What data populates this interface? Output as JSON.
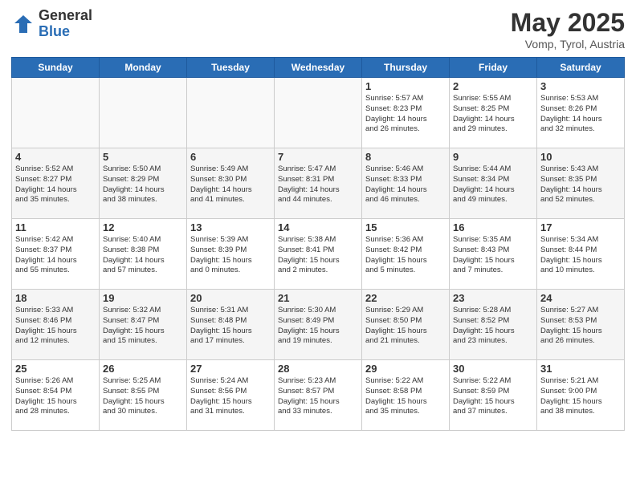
{
  "header": {
    "logo_general": "General",
    "logo_blue": "Blue",
    "month_title": "May 2025",
    "location": "Vomp, Tyrol, Austria"
  },
  "days_of_week": [
    "Sunday",
    "Monday",
    "Tuesday",
    "Wednesday",
    "Thursday",
    "Friday",
    "Saturday"
  ],
  "weeks": [
    [
      {
        "day": "",
        "info": ""
      },
      {
        "day": "",
        "info": ""
      },
      {
        "day": "",
        "info": ""
      },
      {
        "day": "",
        "info": ""
      },
      {
        "day": "1",
        "info": "Sunrise: 5:57 AM\nSunset: 8:23 PM\nDaylight: 14 hours\nand 26 minutes."
      },
      {
        "day": "2",
        "info": "Sunrise: 5:55 AM\nSunset: 8:25 PM\nDaylight: 14 hours\nand 29 minutes."
      },
      {
        "day": "3",
        "info": "Sunrise: 5:53 AM\nSunset: 8:26 PM\nDaylight: 14 hours\nand 32 minutes."
      }
    ],
    [
      {
        "day": "4",
        "info": "Sunrise: 5:52 AM\nSunset: 8:27 PM\nDaylight: 14 hours\nand 35 minutes."
      },
      {
        "day": "5",
        "info": "Sunrise: 5:50 AM\nSunset: 8:29 PM\nDaylight: 14 hours\nand 38 minutes."
      },
      {
        "day": "6",
        "info": "Sunrise: 5:49 AM\nSunset: 8:30 PM\nDaylight: 14 hours\nand 41 minutes."
      },
      {
        "day": "7",
        "info": "Sunrise: 5:47 AM\nSunset: 8:31 PM\nDaylight: 14 hours\nand 44 minutes."
      },
      {
        "day": "8",
        "info": "Sunrise: 5:46 AM\nSunset: 8:33 PM\nDaylight: 14 hours\nand 46 minutes."
      },
      {
        "day": "9",
        "info": "Sunrise: 5:44 AM\nSunset: 8:34 PM\nDaylight: 14 hours\nand 49 minutes."
      },
      {
        "day": "10",
        "info": "Sunrise: 5:43 AM\nSunset: 8:35 PM\nDaylight: 14 hours\nand 52 minutes."
      }
    ],
    [
      {
        "day": "11",
        "info": "Sunrise: 5:42 AM\nSunset: 8:37 PM\nDaylight: 14 hours\nand 55 minutes."
      },
      {
        "day": "12",
        "info": "Sunrise: 5:40 AM\nSunset: 8:38 PM\nDaylight: 14 hours\nand 57 minutes."
      },
      {
        "day": "13",
        "info": "Sunrise: 5:39 AM\nSunset: 8:39 PM\nDaylight: 15 hours\nand 0 minutes."
      },
      {
        "day": "14",
        "info": "Sunrise: 5:38 AM\nSunset: 8:41 PM\nDaylight: 15 hours\nand 2 minutes."
      },
      {
        "day": "15",
        "info": "Sunrise: 5:36 AM\nSunset: 8:42 PM\nDaylight: 15 hours\nand 5 minutes."
      },
      {
        "day": "16",
        "info": "Sunrise: 5:35 AM\nSunset: 8:43 PM\nDaylight: 15 hours\nand 7 minutes."
      },
      {
        "day": "17",
        "info": "Sunrise: 5:34 AM\nSunset: 8:44 PM\nDaylight: 15 hours\nand 10 minutes."
      }
    ],
    [
      {
        "day": "18",
        "info": "Sunrise: 5:33 AM\nSunset: 8:46 PM\nDaylight: 15 hours\nand 12 minutes."
      },
      {
        "day": "19",
        "info": "Sunrise: 5:32 AM\nSunset: 8:47 PM\nDaylight: 15 hours\nand 15 minutes."
      },
      {
        "day": "20",
        "info": "Sunrise: 5:31 AM\nSunset: 8:48 PM\nDaylight: 15 hours\nand 17 minutes."
      },
      {
        "day": "21",
        "info": "Sunrise: 5:30 AM\nSunset: 8:49 PM\nDaylight: 15 hours\nand 19 minutes."
      },
      {
        "day": "22",
        "info": "Sunrise: 5:29 AM\nSunset: 8:50 PM\nDaylight: 15 hours\nand 21 minutes."
      },
      {
        "day": "23",
        "info": "Sunrise: 5:28 AM\nSunset: 8:52 PM\nDaylight: 15 hours\nand 23 minutes."
      },
      {
        "day": "24",
        "info": "Sunrise: 5:27 AM\nSunset: 8:53 PM\nDaylight: 15 hours\nand 26 minutes."
      }
    ],
    [
      {
        "day": "25",
        "info": "Sunrise: 5:26 AM\nSunset: 8:54 PM\nDaylight: 15 hours\nand 28 minutes."
      },
      {
        "day": "26",
        "info": "Sunrise: 5:25 AM\nSunset: 8:55 PM\nDaylight: 15 hours\nand 30 minutes."
      },
      {
        "day": "27",
        "info": "Sunrise: 5:24 AM\nSunset: 8:56 PM\nDaylight: 15 hours\nand 31 minutes."
      },
      {
        "day": "28",
        "info": "Sunrise: 5:23 AM\nSunset: 8:57 PM\nDaylight: 15 hours\nand 33 minutes."
      },
      {
        "day": "29",
        "info": "Sunrise: 5:22 AM\nSunset: 8:58 PM\nDaylight: 15 hours\nand 35 minutes."
      },
      {
        "day": "30",
        "info": "Sunrise: 5:22 AM\nSunset: 8:59 PM\nDaylight: 15 hours\nand 37 minutes."
      },
      {
        "day": "31",
        "info": "Sunrise: 5:21 AM\nSunset: 9:00 PM\nDaylight: 15 hours\nand 38 minutes."
      }
    ]
  ]
}
